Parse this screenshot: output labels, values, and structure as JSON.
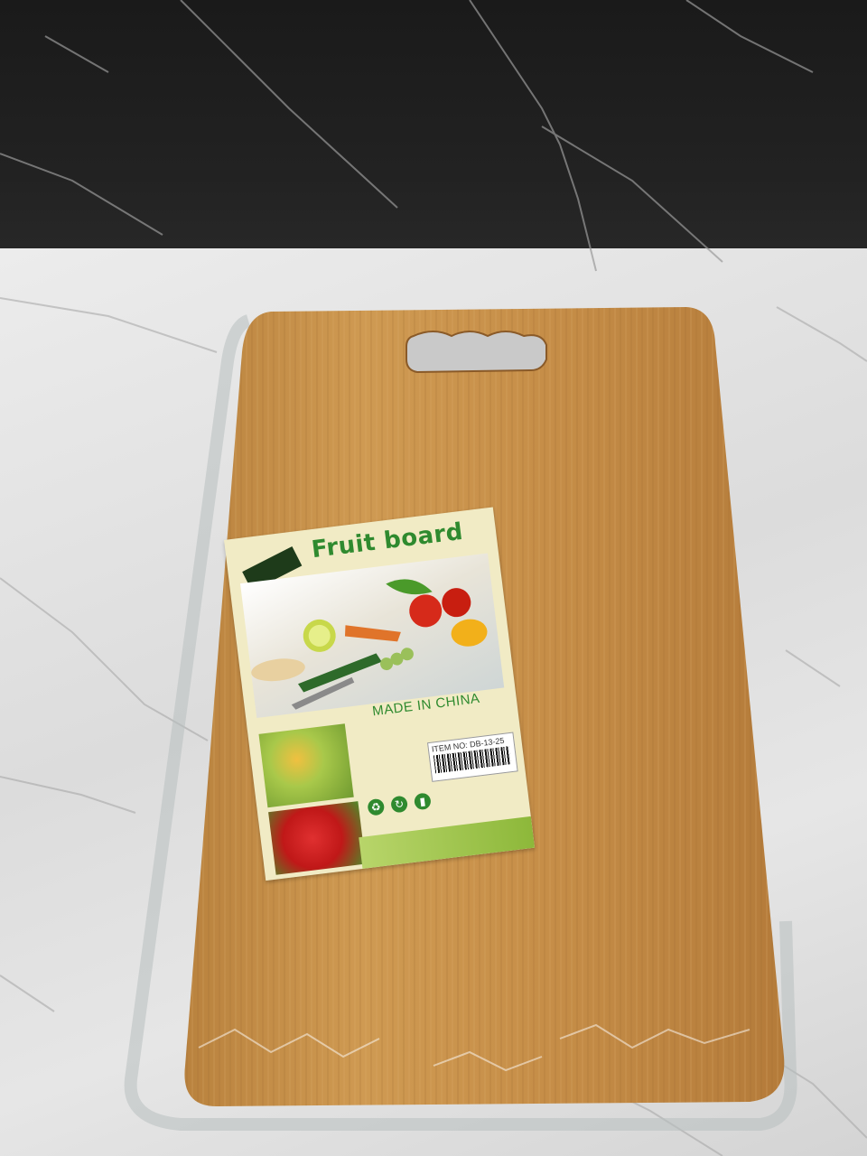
{
  "image": {
    "subject": "bamboo cutting board in shrink wrap with product label",
    "label": {
      "title": "Fruit board",
      "made_in": "MADE IN CHINA",
      "item_no": "ITEM NO: DB-13-25"
    }
  },
  "colors": {
    "wood": "#c8934a",
    "wood_dark": "#a8743a",
    "label_bg": "#f1ebc5",
    "label_green": "#2f8a2f",
    "marble_dark": "#1a1a1a",
    "marble_light": "#e4e4e4"
  },
  "icons": [
    "recycle-icon",
    "green-dot-icon",
    "trash-bin-icon"
  ]
}
